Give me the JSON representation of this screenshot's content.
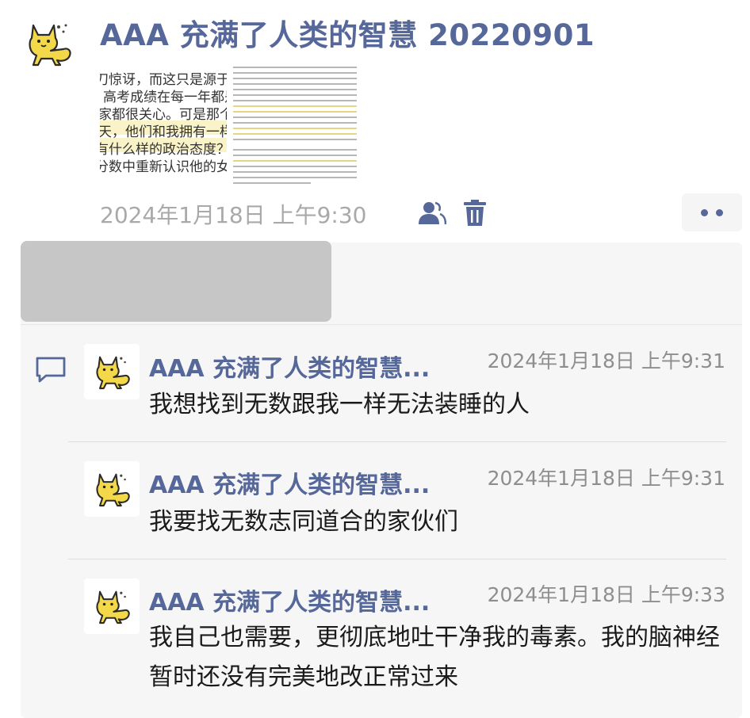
{
  "post": {
    "author": "AAA 充满了人类的智慧 20220901",
    "avatar_icon": "yellow-cat-icon",
    "images": [
      {
        "lines": [
          "刀惊讶，而这只是源于一个",
          "高考成绩在每一年都是人",
          "家都很关心。可是那个成",
          "天，他们和我拥有一样的",
          "有什么样的政治态度？这些",
          "分数中重新认识他的女儿"
        ]
      },
      {
        "icon": "document-page-image"
      }
    ],
    "timestamp": "2024年1月18日 上午9:30",
    "privacy_icon": "people-icon",
    "delete_icon": "trash-icon",
    "more_icon": "more-dots-icon"
  },
  "comments_icon": "comment-bubble-icon",
  "comments": [
    {
      "name": "AAA 充满了人类的智慧...",
      "time": "2024年1月18日 上午9:31",
      "text": "我想找到无数跟我一样无法装睡的人"
    },
    {
      "name": "AAA 充满了人类的智慧...",
      "time": "2024年1月18日 上午9:31",
      "text": "我要找无数志同道合的家伙们"
    },
    {
      "name": "AAA 充满了人类的智慧...",
      "time": "2024年1月18日 上午9:33",
      "text": "我自己也需要，更彻底地吐干净我的毒素。我的脑神经暂时还没有完美地改正常过来"
    }
  ],
  "colors": {
    "name": "#56679a",
    "meta": "#a9a9a9",
    "panel": "#f6f6f6",
    "highlight": "#fbf3c8"
  }
}
